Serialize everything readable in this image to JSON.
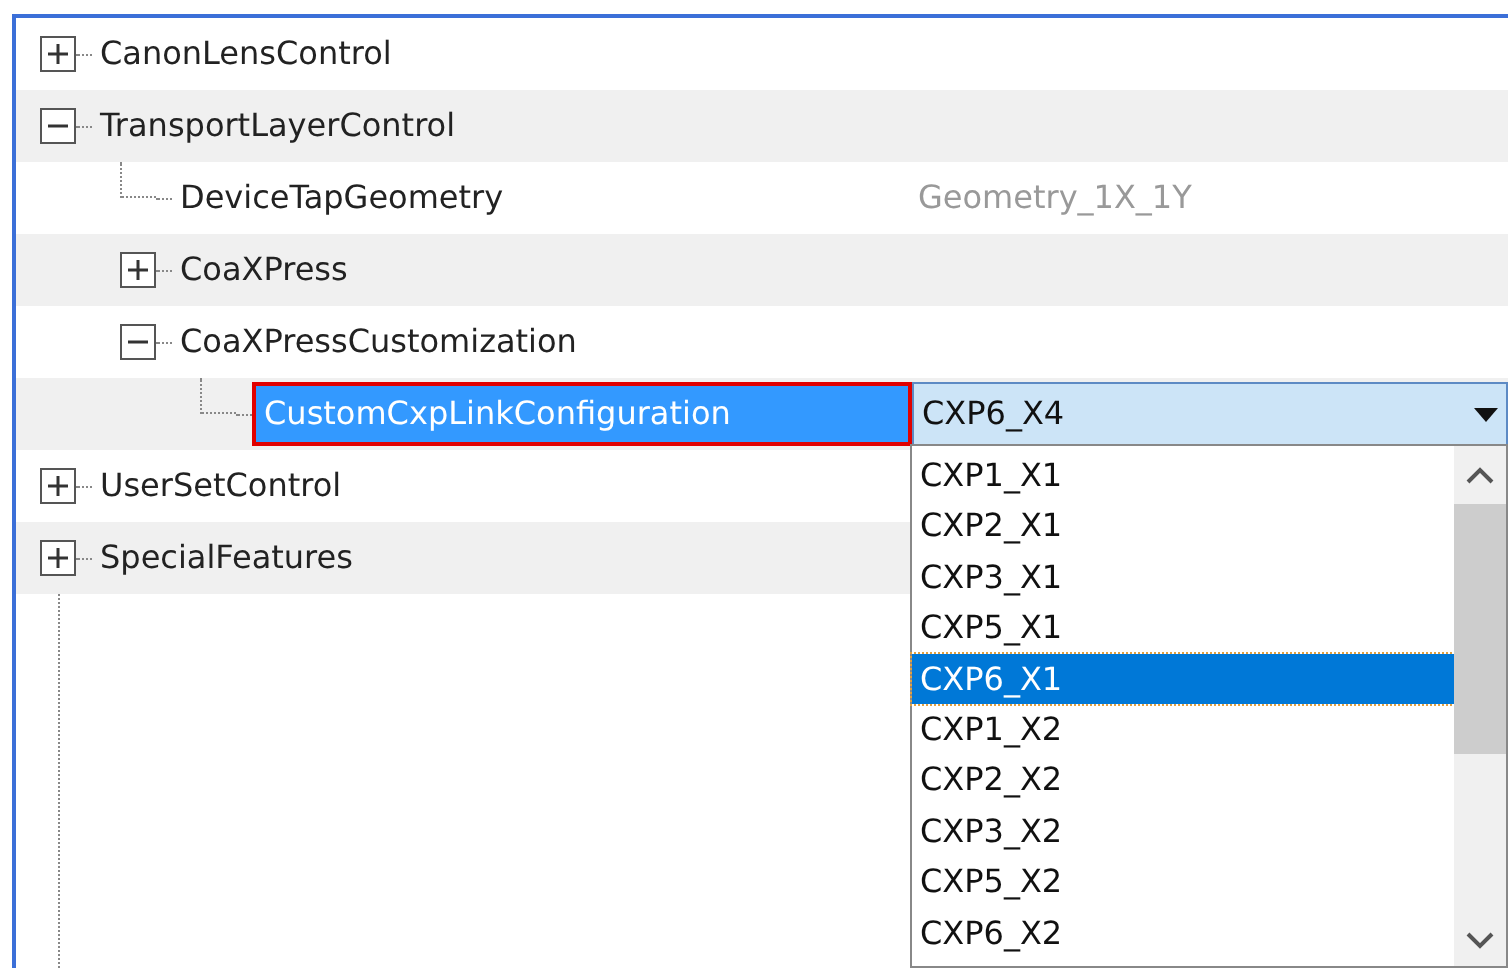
{
  "tree": [
    {
      "label": "CanonLensControl",
      "expanded": false
    },
    {
      "label": "TransportLayerControl",
      "expanded": true,
      "children": [
        {
          "label": "DeviceTapGeometry",
          "value": "Geometry_1X_1Y"
        },
        {
          "label": "CoaXPress",
          "expanded": false
        },
        {
          "label": "CoaXPressCustomization",
          "expanded": true,
          "children": [
            {
              "label": "CustomCxpLinkConfiguration",
              "selected": true,
              "value": "CXP6_X4",
              "kind": "combo"
            }
          ]
        }
      ]
    },
    {
      "label": "UserSetControl",
      "expanded": false
    },
    {
      "label": "SpecialFeatures",
      "expanded": false
    }
  ],
  "dropdown": {
    "options": [
      {
        "label": "CXP1_X1",
        "selected": false
      },
      {
        "label": "CXP2_X1",
        "selected": false
      },
      {
        "label": "CXP3_X1",
        "selected": false
      },
      {
        "label": "CXP5_X1",
        "selected": false
      },
      {
        "label": "CXP6_X1",
        "selected": true
      },
      {
        "label": "CXP1_X2",
        "selected": false
      },
      {
        "label": "CXP2_X2",
        "selected": false
      },
      {
        "label": "CXP3_X2",
        "selected": false
      },
      {
        "label": "CXP5_X2",
        "selected": false
      },
      {
        "label": "CXP6_X2",
        "selected": false
      }
    ]
  }
}
